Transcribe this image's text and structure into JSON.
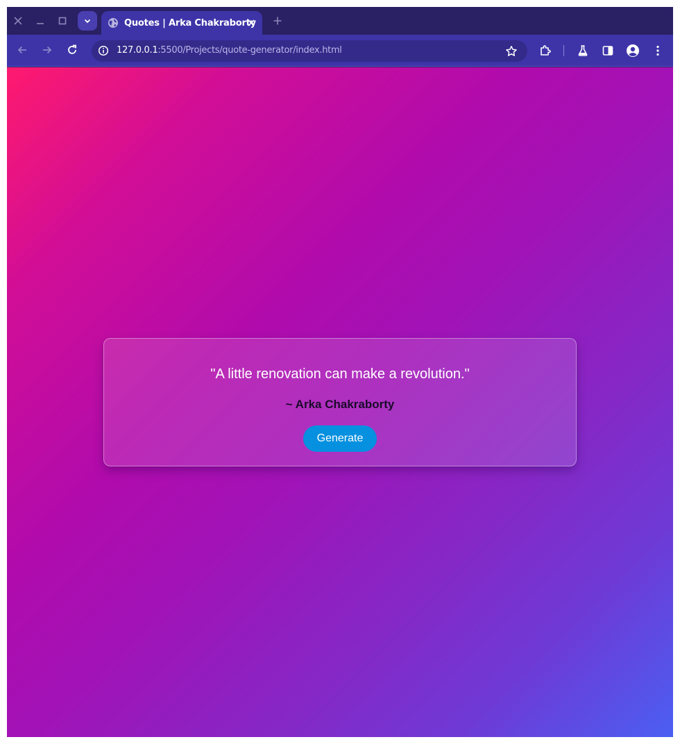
{
  "browser": {
    "tab": {
      "title": "Quotes | Arka Chakraborty",
      "favicon": "globe-icon"
    },
    "url": {
      "host": "127.0.0.1",
      "rest": ":5500/Projects/quote-generator/index.html"
    },
    "colors": {
      "frame": "#2a2165",
      "toolbar": "#3e34a8",
      "omnibox": "#332a8a"
    }
  },
  "page": {
    "background_gradient": [
      "#ff1a6e",
      "#b10bac",
      "#4b5ff2"
    ],
    "card": {
      "quote": "\"A little renovation can make a revolution.\"",
      "author": "~ Arka Chakraborty",
      "button_label": "Generate",
      "button_color": "#0690e0"
    }
  }
}
